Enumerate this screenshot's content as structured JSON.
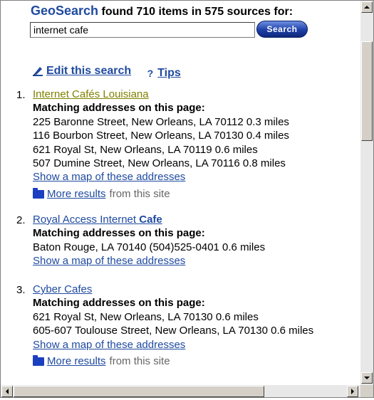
{
  "header": {
    "brand": "GeoSearch",
    "summary": "found 710 items in 575 sources for:"
  },
  "search": {
    "value": "internet cafe",
    "button_label": "Search"
  },
  "tools": {
    "edit_label": "Edit this search",
    "tips_label": "Tips",
    "tips_glyph": "?"
  },
  "results": [
    {
      "number": "1.",
      "title": "Internet Cafés Louisiana",
      "visited": true,
      "matching_heading": "Matching addresses on this page:",
      "addresses": [
        "225 Baronne Street, New Orleans, LA 70112   0.3 miles",
        "116 Bourbon Street, New Orleans, LA 70130   0.4 miles",
        "621 Royal St, New Orleans, LA 70119   0.6 miles",
        "507 Dumine Street, New Orleans, LA 70116   0.8 miles"
      ],
      "map_link": "Show a map of these addresses",
      "map_visited": false,
      "more_results": "More results",
      "from_site": "from this site"
    },
    {
      "number": "2.",
      "title_plain": "Royal Access Internet ",
      "title_bold": "Cafe",
      "matching_heading": "Matching addresses on this page:",
      "addresses": [
        "Baton Rouge, LA 70140  (504)525-0401   0.6 miles"
      ],
      "map_link": "Show a map of these addresses",
      "map_visited": true
    },
    {
      "number": "3.",
      "title": "Cyber Cafes",
      "matching_heading": "Matching addresses on this page:",
      "addresses": [
        "621 Royal St, New Orleans, LA 70130   0.6 miles",
        "605-607 Toulouse Street, New Orleans, LA 70130   0.6 miles"
      ],
      "map_link": "Show a map of these addresses",
      "map_visited": false,
      "more_results": "More results",
      "from_site": "from this site"
    }
  ],
  "icons": {
    "edit": "pencil-icon",
    "tips": "question-icon",
    "more": "folder-icon",
    "scroll_up": "arrow-up-icon",
    "scroll_down": "arrow-down-icon",
    "scroll_left": "arrow-left-icon",
    "scroll_right": "arrow-right-icon"
  },
  "colors": {
    "link": "#1f4aa0",
    "visited_link": "#808000",
    "brand": "#1f4aa0",
    "search_button": "#1d3fa8",
    "folder": "#1a3fbf"
  }
}
